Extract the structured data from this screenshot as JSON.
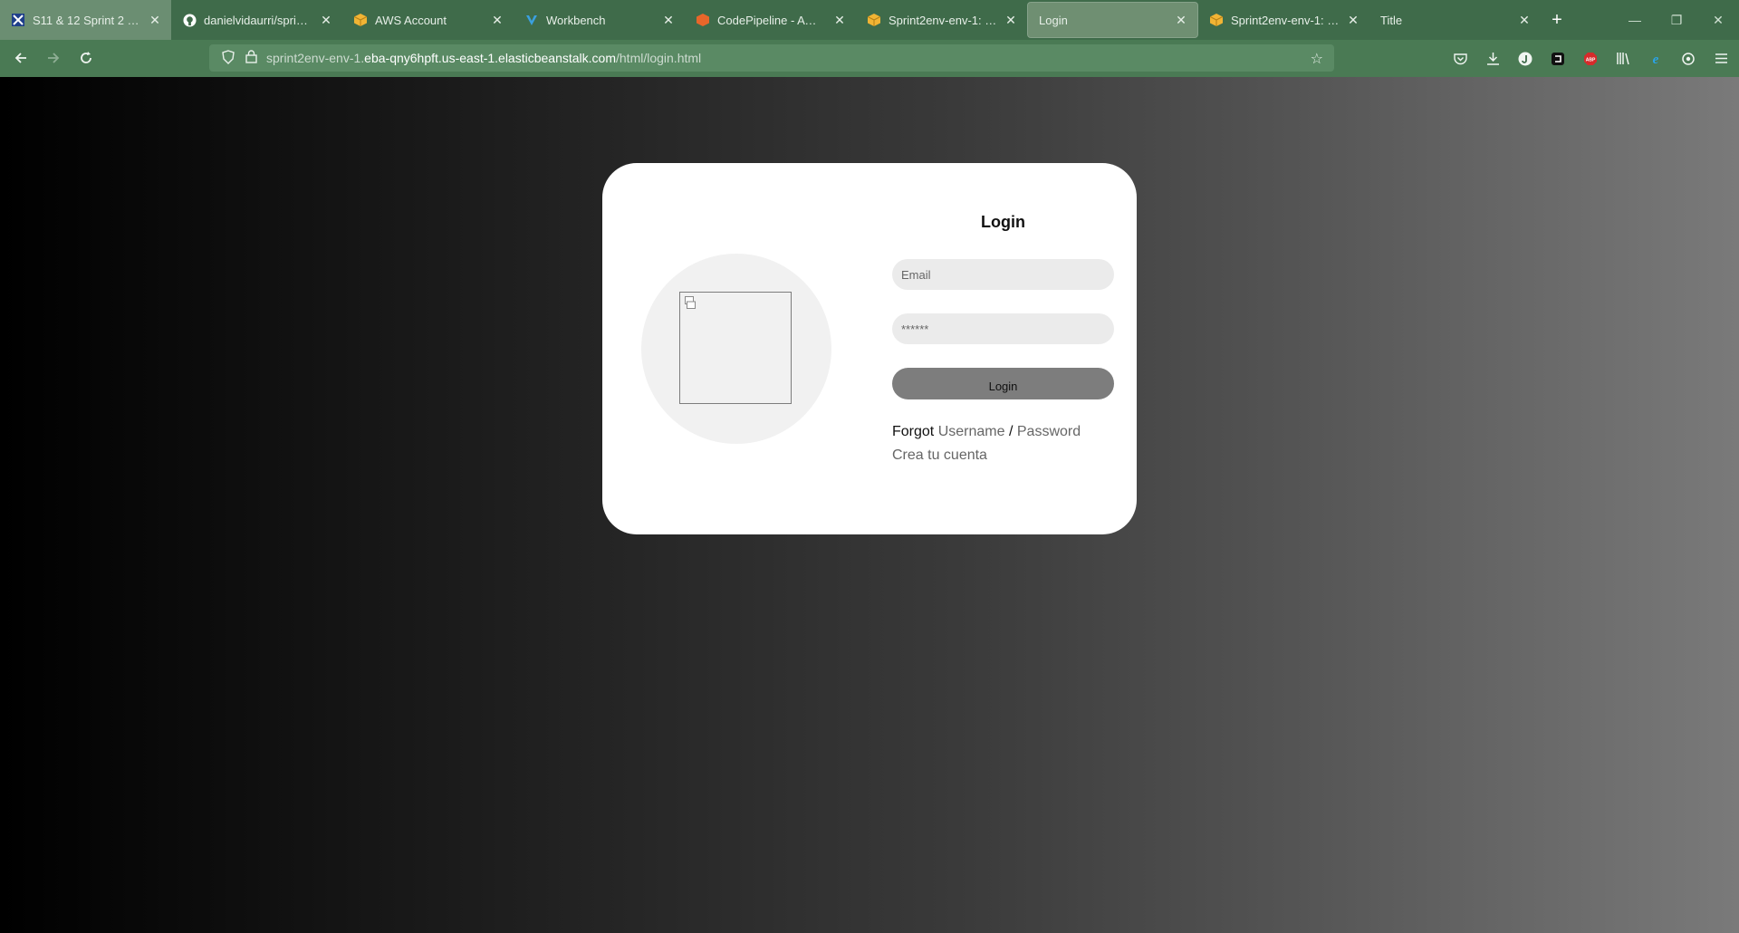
{
  "browser": {
    "tabs": [
      {
        "title": "S11 & 12 Sprint 2 PaaS |",
        "icon": "jira-icon",
        "state": "pinned-highlight"
      },
      {
        "title": "danielvidaurri/sprint02",
        "icon": "github-icon"
      },
      {
        "title": "AWS Account",
        "icon": "aws-box-icon"
      },
      {
        "title": "Workbench",
        "icon": "vocareum-icon"
      },
      {
        "title": "CodePipeline - AWS Dev",
        "icon": "codepipeline-icon"
      },
      {
        "title": "Sprint2env-env-1: Panel",
        "icon": "aws-box-icon"
      },
      {
        "title": "Login",
        "icon": "",
        "state": "active"
      },
      {
        "title": "Sprint2env-env-1: Panel",
        "icon": "aws-box-icon"
      },
      {
        "title": "Title",
        "icon": ""
      }
    ],
    "new_tab_label": "+",
    "url": {
      "prefix": "sprint2env-env-1.",
      "host": "eba-qny6hpft.us-east-1.elasticbeanstalk.com",
      "path": "/html/login.html"
    },
    "colors": {
      "chrome": "#3f6b4a",
      "toolbar": "#4a7a54"
    }
  },
  "page": {
    "title": "Login",
    "email_placeholder": "Email",
    "password_placeholder": "******",
    "login_button": "Login",
    "forgot_prefix": "Forgot",
    "forgot_username": "Username",
    "forgot_separator": "/",
    "forgot_password": "Password",
    "create_account": "Crea tu cuenta"
  }
}
